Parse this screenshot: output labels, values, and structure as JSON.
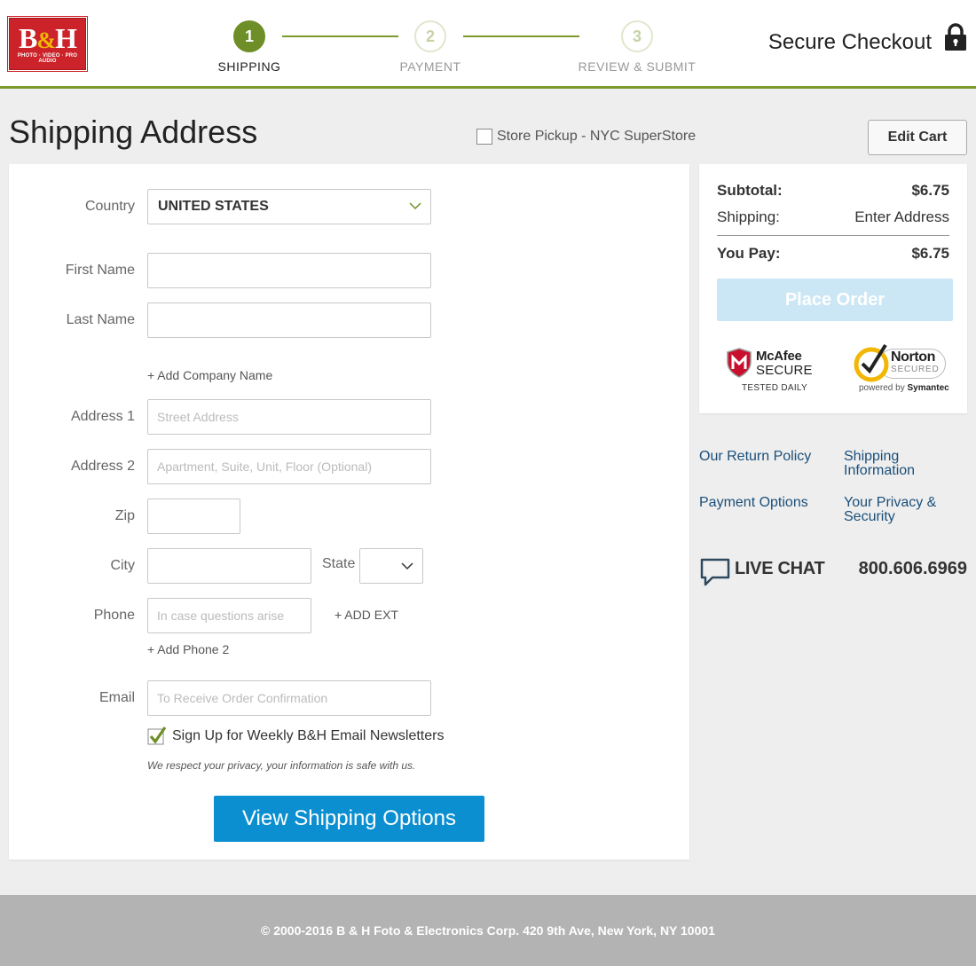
{
  "header": {
    "logo_text": "B&H",
    "logo_sub": "PHOTO · VIDEO · PRO AUDIO",
    "steps": [
      {
        "number": "1",
        "label": "SHIPPING"
      },
      {
        "number": "2",
        "label": "PAYMENT"
      },
      {
        "number": "3",
        "label": "REVIEW & SUBMIT"
      }
    ],
    "secure_checkout": "Secure Checkout"
  },
  "page": {
    "title": "Shipping Address",
    "store_pickup": "Store Pickup - NYC SuperStore",
    "edit_cart": "Edit Cart"
  },
  "form": {
    "country_label": "Country",
    "country_value": "UNITED STATES",
    "first_name_label": "First Name",
    "last_name_label": "Last Name",
    "add_company": "+ Add Company Name",
    "address1_label": "Address 1",
    "address1_placeholder": "Street Address",
    "address2_label": "Address 2",
    "address2_placeholder": "Apartment, Suite, Unit, Floor (Optional)",
    "zip_label": "Zip",
    "city_label": "City",
    "state_label": "State",
    "phone_label": "Phone",
    "phone_placeholder": "In case questions arise",
    "add_ext": "+ ADD EXT",
    "add_phone2": "+ Add Phone 2",
    "email_label": "Email",
    "email_placeholder": "To Receive Order Confirmation",
    "newsletter": "Sign Up for Weekly B&H Email Newsletters",
    "privacy": "We respect your privacy, your information is safe with us.",
    "view_shipping": "View Shipping Options"
  },
  "summary": {
    "subtotal_label": "Subtotal:",
    "subtotal_value": "$6.75",
    "shipping_label": "Shipping:",
    "shipping_value": "Enter Address",
    "you_pay_label": "You Pay:",
    "you_pay_value": "$6.75",
    "place_order": "Place Order",
    "mcafee_name": "McAfee",
    "mcafee_secure": "SECURE",
    "mcafee_tested": "TESTED DAILY",
    "norton_name": "Norton",
    "norton_secured": "SECURED",
    "norton_powered_prefix": "powered by ",
    "norton_powered_brand": "Symantec"
  },
  "help": {
    "return_policy": "Our Return Policy",
    "shipping_info_1": "Shipping",
    "shipping_info_2": "Information",
    "payment_options": "Payment Options",
    "privacy_1": "Your Privacy &",
    "privacy_2": "Security",
    "live_chat": "LIVE CHAT",
    "phone": "800.606.6969"
  },
  "footer": {
    "copyright": "© 2000-2016 B & H Foto & Electronics Corp. 420 9th Ave, New York, NY 10001"
  },
  "colors": {
    "accent_green": "#6e8f27",
    "primary_blue": "#0b8fd0",
    "link_blue": "#1b4f7a",
    "brand_red": "#cc2229"
  }
}
